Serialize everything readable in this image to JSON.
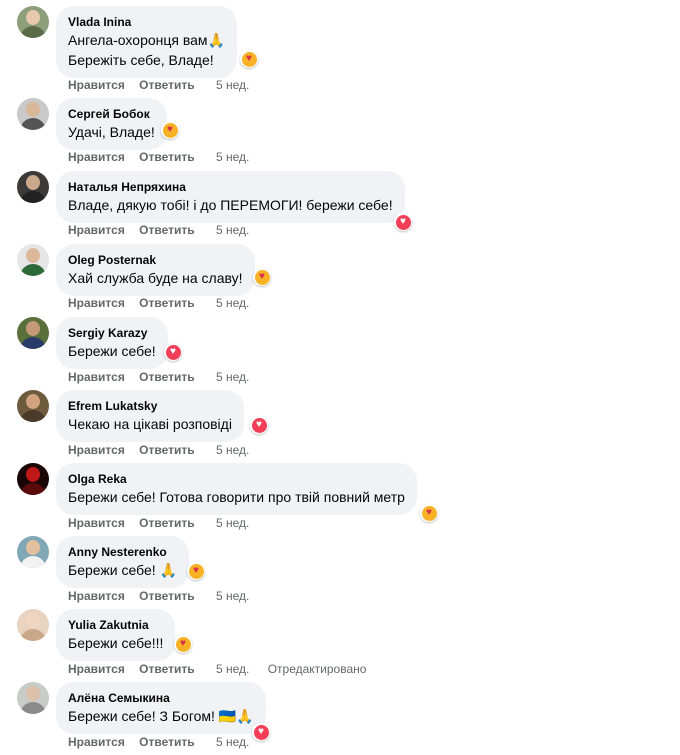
{
  "actions": {
    "like": "Нравится",
    "reply": "Ответить"
  },
  "comments": [
    {
      "author": "Vlada Inina",
      "lines": [
        "Ангела-охоронця вам🙏",
        "Бережіть себе, Владе!"
      ],
      "time": "5 нед.",
      "edited": "",
      "reaction": "care-icon",
      "avatar_color": "#8d9f7a"
    },
    {
      "author": "Сергей Бобок",
      "lines": [
        "Удачі, Владе!"
      ],
      "time": "5 нед.",
      "edited": "",
      "reaction": "care-icon",
      "avatar_color": "#b9b9b9"
    },
    {
      "author": "Наталья Непряхина",
      "lines": [
        "Владе, дякую тобі! і до ПЕРЕМОГИ! бережи себе!"
      ],
      "time": "5 нед.",
      "edited": "",
      "reaction": "love-icon",
      "avatar_color": "#3c3a38"
    },
    {
      "author": "Oleg Posternak",
      "lines": [
        "Хай служба буде на славу!"
      ],
      "time": "5 нед.",
      "edited": "",
      "reaction": "care-icon",
      "avatar_color": "#e6e6e6"
    },
    {
      "author": "Sergiy Karazy",
      "lines": [
        "Бережи себе!"
      ],
      "time": "5 нед.",
      "edited": "",
      "reaction": "love-icon",
      "avatar_color": "#5a6f3c"
    },
    {
      "author": "Efrem Lukatsky",
      "lines": [
        "Чекаю на цікаві розповіді"
      ],
      "time": "5 нед.",
      "edited": "",
      "reaction": "love-icon",
      "avatar_color": "#6e5a3c"
    },
    {
      "author": "Olga Reka",
      "lines": [
        "Бережи себе! Готова говорити про твій повний метр"
      ],
      "time": "5 нед.",
      "edited": "",
      "reaction": "care-icon",
      "avatar_color": "#8a1010"
    },
    {
      "author": "Anny Nesterenko",
      "lines": [
        "Бережи себе! 🙏"
      ],
      "time": "5 нед.",
      "edited": "",
      "reaction": "care-icon",
      "avatar_color": "#7fa7b5"
    },
    {
      "author": "Yulia Zakutnia",
      "lines": [
        "Бережи себе!!!"
      ],
      "time": "5 нед.",
      "edited": "Отредактировано",
      "reaction": "care-icon",
      "avatar_color": "#e8d2c0"
    },
    {
      "author": "Алёна Семыкина",
      "lines": [
        "Бережи себе! З Богом! 🇺🇦🙏"
      ],
      "time": "5 нед.",
      "edited": "",
      "reaction": "love-icon",
      "avatar_color": "#c8ccc8"
    }
  ],
  "colors": {
    "bubble": "#f0f2f5",
    "meta": "#65676b",
    "love": "#f33e58",
    "care": "#f7b125"
  }
}
